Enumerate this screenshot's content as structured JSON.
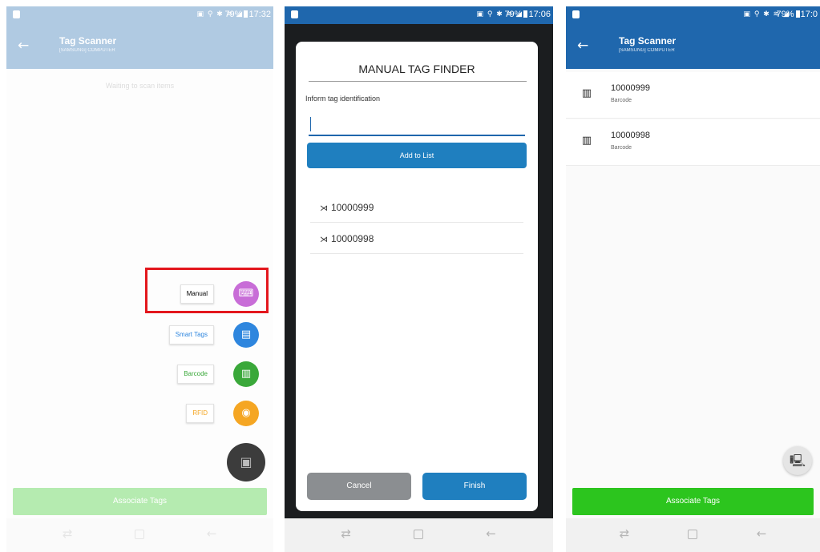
{
  "status": {
    "time_1": "17:32",
    "time_2": "17:06",
    "time_3": "17:0",
    "battery": "79%",
    "icons": "▣ ⚲ ✱ ≋ ◢"
  },
  "appbar": {
    "title": "Tag Scanner",
    "subtitle": "[SAMSUNG] COMPUTER"
  },
  "screen1": {
    "waiting": "Waiting to scan items",
    "speed_dial": [
      {
        "label": "Manual",
        "icon": "keyboard-icon",
        "glyph": "⌨",
        "color": "#c86dd7"
      },
      {
        "label": "Smart Tags",
        "icon": "smart-tag-icon",
        "glyph": "▤",
        "color": "#2e86de"
      },
      {
        "label": "Barcode",
        "icon": "barcode-icon",
        "glyph": "▥",
        "color": "#3aa83a"
      },
      {
        "label": "RFID",
        "icon": "rfid-icon",
        "glyph": "◉",
        "color": "#f5a623"
      }
    ],
    "main_fab_glyph": "▣",
    "associate_button": "Associate Tags",
    "highlight_color": "#e3171d"
  },
  "screen2": {
    "dialog_title": "MANUAL TAG FINDER",
    "inform_label": "Inform tag identification",
    "input_value": "",
    "add_button": "Add to List",
    "items": [
      {
        "icon_glyph": "⋊",
        "code": "10000999"
      },
      {
        "icon_glyph": "⋊",
        "code": "10000998"
      }
    ],
    "cancel_button": "Cancel",
    "finish_button": "Finish"
  },
  "screen3": {
    "tags": [
      {
        "code": "10000999",
        "type": "Barcode",
        "icon_glyph": "▥"
      },
      {
        "code": "10000998",
        "type": "Barcode",
        "icon_glyph": "▥"
      }
    ],
    "fab_glyph": "🖳",
    "associate_button": "Associate Tags"
  },
  "nav": {
    "recent_glyph": "⇄",
    "back_glyph": "←"
  },
  "colors": {
    "primary": "#1f67ad",
    "associate": "#2cc51e",
    "button_blue": "#1f7fbf"
  }
}
